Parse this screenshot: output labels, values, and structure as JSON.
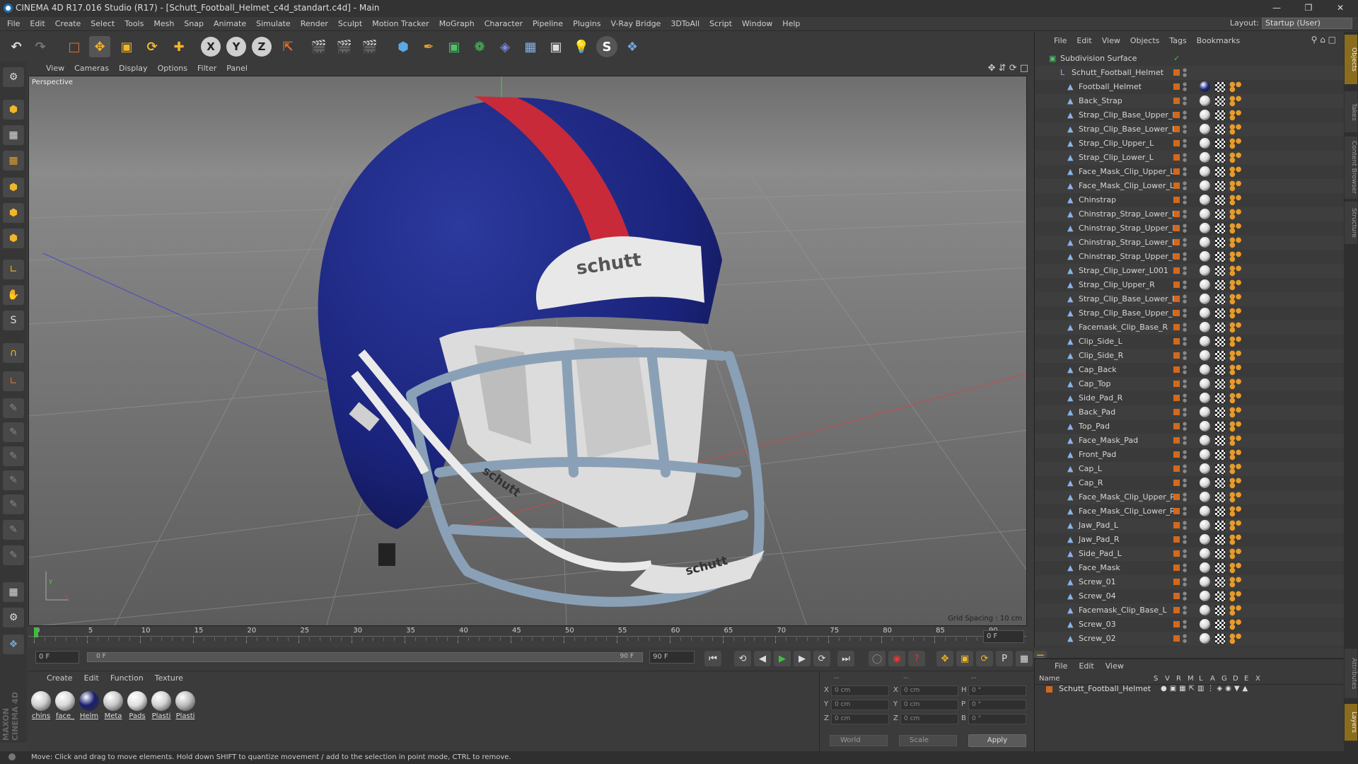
{
  "title": "CINEMA 4D R17.016 Studio (R17) - [Schutt_Football_Helmet_c4d_standart.c4d] - Main",
  "menu": [
    "File",
    "Edit",
    "Create",
    "Select",
    "Tools",
    "Mesh",
    "Snap",
    "Animate",
    "Simulate",
    "Render",
    "Sculpt",
    "Motion Tracker",
    "MoGraph",
    "Character",
    "Pipeline",
    "Plugins",
    "V-Ray Bridge",
    "3DToAll",
    "Script",
    "Window",
    "Help"
  ],
  "layout": {
    "label": "Layout:",
    "value": "Startup (User)"
  },
  "viewport": {
    "menu": [
      "View",
      "Cameras",
      "Display",
      "Options",
      "Filter",
      "Panel"
    ],
    "camera": "Perspective",
    "grid_spacing": "Grid Spacing : 10 cm",
    "brand_text": "schutt"
  },
  "timeline": {
    "ticks": [
      "0",
      "5",
      "10",
      "15",
      "20",
      "25",
      "30",
      "35",
      "40",
      "45",
      "50",
      "55",
      "60",
      "65",
      "70",
      "75",
      "80",
      "85",
      "90"
    ],
    "current": "0 F"
  },
  "transport": {
    "start": "0 F",
    "range_start": "0 F",
    "range_end": "90 F",
    "end": "90 F"
  },
  "material_manager": {
    "menu": [
      "Create",
      "Edit",
      "Function",
      "Texture"
    ],
    "materials": [
      {
        "label": "chins",
        "color": "#cfcfcf"
      },
      {
        "label": "face_",
        "color": "#d8d8d8"
      },
      {
        "label": "Helm",
        "color": "#1a1f6e"
      },
      {
        "label": "Meta",
        "color": "#c8c8c8"
      },
      {
        "label": "Pads",
        "color": "#e0e0e0"
      },
      {
        "label": "Plasti",
        "color": "#d2d2d2"
      },
      {
        "label": "Plasti",
        "color": "#bdbdbd"
      }
    ]
  },
  "coordinates": {
    "dashes": [
      "--",
      "--",
      "--"
    ],
    "rows": [
      {
        "a": "X",
        "av": "0 cm",
        "b": "X",
        "bv": "0 cm",
        "c": "H",
        "cv": "0 °"
      },
      {
        "a": "Y",
        "av": "0 cm",
        "b": "Y",
        "bv": "0 cm",
        "c": "P",
        "cv": "0 °"
      },
      {
        "a": "Z",
        "av": "0 cm",
        "b": "Z",
        "bv": "0 cm",
        "c": "B",
        "cv": "0 °"
      }
    ],
    "space": "World",
    "mode": "Scale",
    "apply": "Apply"
  },
  "status": "Move: Click and drag to move elements. Hold down SHIFT to quantize movement / add to the selection in point mode, CTRL to remove.",
  "object_manager": {
    "menu": [
      "File",
      "Edit",
      "View",
      "Objects",
      "Tags",
      "Bookmarks"
    ],
    "root": "Subdivision Surface",
    "group": "Schutt_Football_Helmet",
    "objects": [
      "Football_Helmet",
      "Back_Strap",
      "Strap_Clip_Base_Upper_L",
      "Strap_Clip_Base_Lower_L",
      "Strap_Clip_Upper_L",
      "Strap_Clip_Lower_L",
      "Face_Mask_Clip_Upper_L",
      "Face_Mask_Clip_Lower_L",
      "Chinstrap",
      "Chinstrap_Strap_Lower_L",
      "Chinstrap_Strap_Upper_L",
      "Chinstrap_Strap_Lower_R",
      "Chinstrap_Strap_Upper_R",
      "Strap_Clip_Lower_L001",
      "Strap_Clip_Upper_R",
      "Strap_Clip_Base_Lower_R",
      "Strap_Clip_Base_Upper_R",
      "Facemask_Clip_Base_R",
      "Clip_Side_L",
      "Clip_Side_R",
      "Cap_Back",
      "Cap_Top",
      "Side_Pad_R",
      "Back_Pad",
      "Top_Pad",
      "Face_Mask_Pad",
      "Front_Pad",
      "Cap_L",
      "Cap_R",
      "Face_Mask_Clip_Upper_R",
      "Face_Mask_Clip_Lower_R",
      "Jaw_Pad_L",
      "Jaw_Pad_R",
      "Side_Pad_L",
      "Face_Mask",
      "Screw_01",
      "Screw_04",
      "Facemask_Clip_Base_L",
      "Screw_03",
      "Screw_02"
    ]
  },
  "attribute_manager": {
    "menu": [
      "File",
      "Edit",
      "View"
    ],
    "columns": [
      "Name",
      "S",
      "V",
      "R",
      "M",
      "L",
      "A",
      "G",
      "D",
      "E",
      "X"
    ],
    "layer": "Schutt_Football_Helmet"
  },
  "side_tabs": [
    "Objects",
    "Takes",
    "Content Browser",
    "Structure",
    "Attributes",
    "Layers"
  ],
  "brand": "MAXON CINEMA 4D"
}
